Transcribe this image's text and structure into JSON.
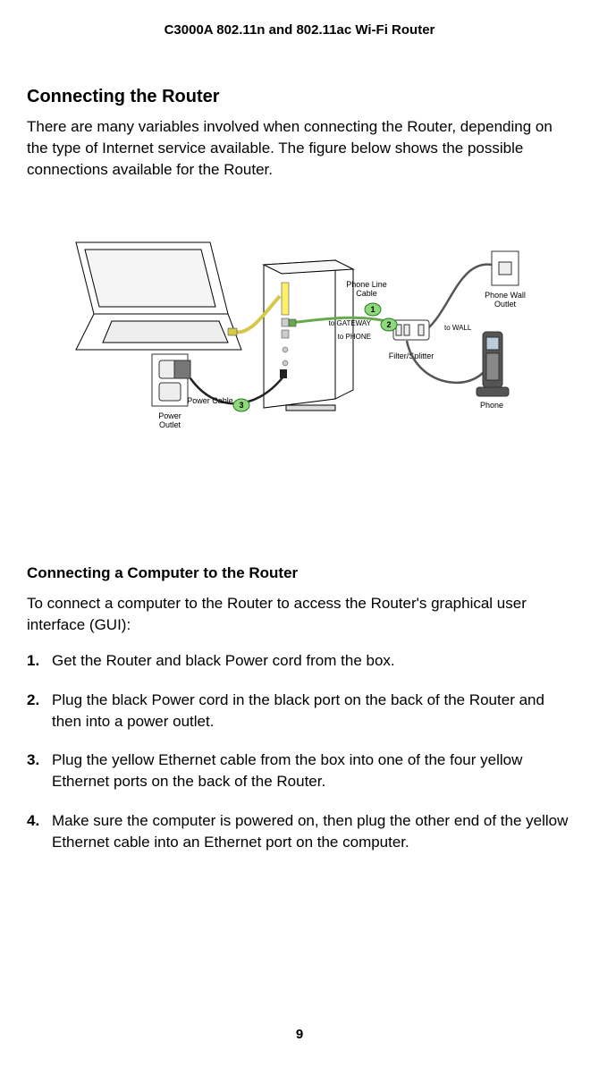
{
  "header": "C3000A 802.11n and 802.11ac Wi-Fi Router",
  "section1": {
    "title": "Connecting the Router",
    "intro": "There are many variables involved when connecting the Router, depending on the type of Internet service available. The figure below shows the possible connections available for the Router."
  },
  "diagram": {
    "labels": {
      "phone_line_cable": "Phone Line\nCable",
      "phone_wall_outlet": "Phone Wall\nOutlet",
      "to_gateway": "to GATEWAY",
      "to_wall": "to WALL",
      "to_phone": "to PHONE",
      "filter_splitter": "Filter/Splitter",
      "phone": "Phone",
      "power_cable": "Power Cable",
      "power_outlet": "Power\nOutlet"
    },
    "callouts": {
      "one": "1",
      "two": "2",
      "three": "3"
    }
  },
  "section2": {
    "title": "Connecting a Computer to the Router",
    "intro": "To connect a computer to the Router to access the Router's graphical user interface (GUI):",
    "steps": [
      "Get the Router and black Power cord from the box.",
      "Plug the black Power cord in the black port on the back of the Router and then into a power outlet.",
      "Plug the yellow Ethernet cable from the box into one of the four yellow Ethernet ports on the back of the Router.",
      "Make sure the computer is powered on, then plug the other end of the yellow Ethernet cable into an Ethernet port on the computer."
    ]
  },
  "page_number": "9"
}
